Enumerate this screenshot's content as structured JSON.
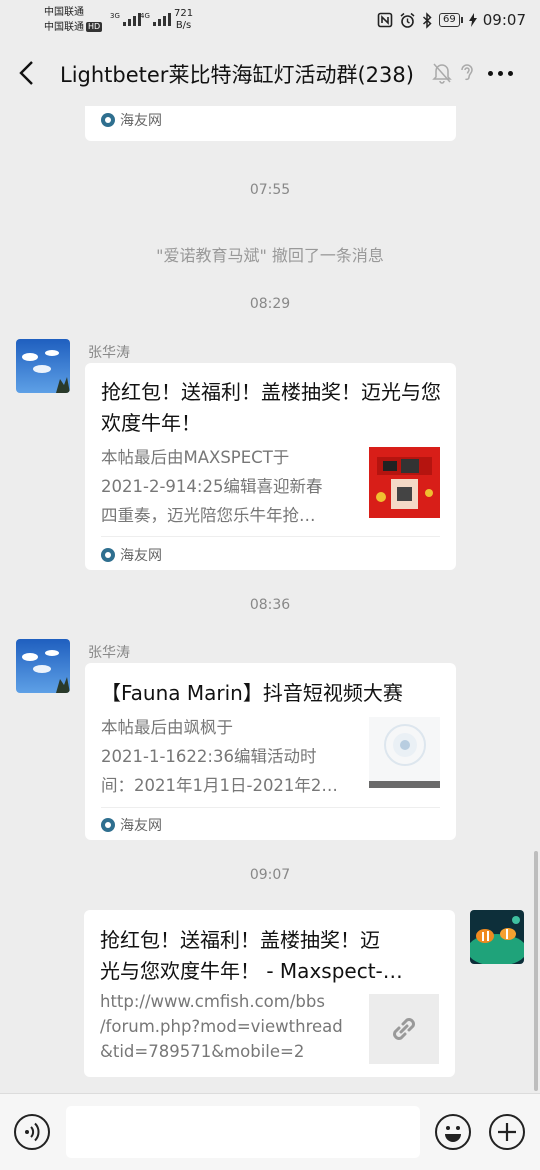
{
  "status_bar": {
    "carrier1": "中国联通",
    "carrier2": "中国联通",
    "carrier2_badge": "HD",
    "signal1_label": "3G",
    "signal2_label": "4G",
    "net_speed_value": "721",
    "net_speed_unit": "B/s",
    "battery": "69",
    "time": "09:07",
    "icons": [
      "nfc-icon",
      "alarm-icon",
      "bluetooth-icon",
      "battery-icon",
      "charging-icon"
    ]
  },
  "header": {
    "title": "Lightbeter莱比特海缸灯活动群(238)",
    "icons": [
      "back-icon",
      "mute-icon",
      "ear-icon",
      "more-icon"
    ]
  },
  "messages": {
    "m0": {
      "source": "海友网"
    },
    "ts1": "07:55",
    "recall": "\"爱诺教育马斌\" 撤回了一条消息",
    "ts2": "08:29",
    "m1": {
      "sender": "张华涛",
      "title": "抢红包！送福利！盖楼抽奖！迈光与您欢度牛年！",
      "desc_line1": "本帖最后由MAXSPECT于",
      "desc_line2": "2021-2-914:25编辑喜迎新春",
      "desc_line3": "四重奏，迈光陪您乐牛年抢…",
      "source": "海友网"
    },
    "ts3": "08:36",
    "m2": {
      "sender": "张华涛",
      "title": "【Fauna Marin】抖音短视频大赛",
      "desc_line1": "本帖最后由飒枫于",
      "desc_line2": "2021-1-1622:36编辑活动时",
      "desc_line3": "间：2021年1月1日-2021年2…",
      "source": "海友网"
    },
    "ts4": "09:07",
    "m3": {
      "title_line1": "抢红包！送福利！盖楼抽奖！迈",
      "title_line2": "光与您欢度牛年！ - Maxspect-…",
      "url_line1": "http://www.cmfish.com/bbs",
      "url_line2": "/forum.php?mod=viewthread",
      "url_line3": "&tid=789571&mobile=2"
    }
  },
  "input_bar": {
    "icons": [
      "voice-icon",
      "emoji-icon",
      "plus-icon"
    ],
    "text_value": ""
  },
  "colors": {
    "background": "#ededed",
    "bubble": "#ffffff",
    "timestamp": "#888888"
  }
}
